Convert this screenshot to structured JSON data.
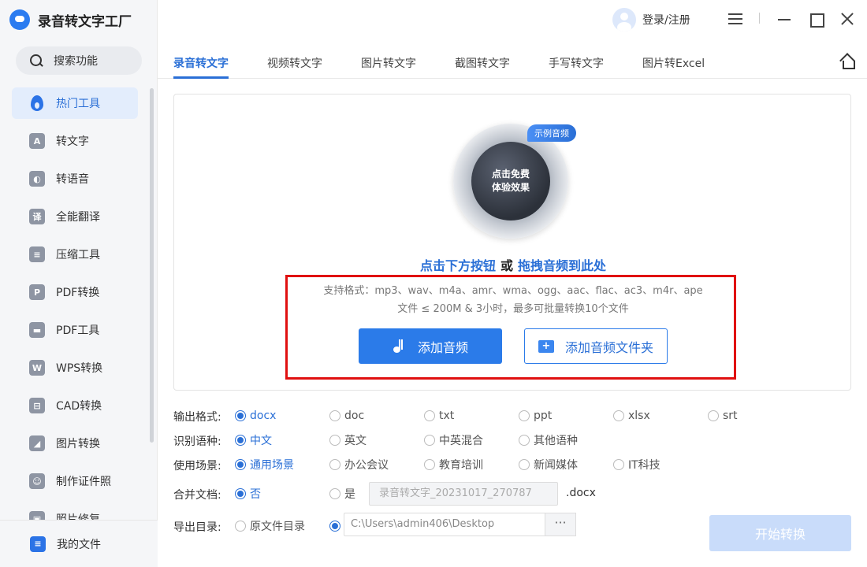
{
  "app": {
    "title": "录音转文字工厂"
  },
  "search": {
    "label": "搜索功能"
  },
  "sidebar": {
    "items": [
      {
        "label": "热门工具",
        "icon": "flame-icon",
        "glyph": ""
      },
      {
        "label": "转文字",
        "icon": "text-icon",
        "glyph": "A"
      },
      {
        "label": "转语音",
        "icon": "voice-icon",
        "glyph": "◐"
      },
      {
        "label": "全能翻译",
        "icon": "translate-icon",
        "glyph": "译"
      },
      {
        "label": "压缩工具",
        "icon": "compress-icon",
        "glyph": "≡"
      },
      {
        "label": "PDF转换",
        "icon": "pdf-icon",
        "glyph": "P"
      },
      {
        "label": "PDF工具",
        "icon": "briefcase-icon",
        "glyph": "▬"
      },
      {
        "label": "WPS转换",
        "icon": "wps-icon",
        "glyph": "W"
      },
      {
        "label": "CAD转换",
        "icon": "cad-icon",
        "glyph": "⊟"
      },
      {
        "label": "图片转换",
        "icon": "image-icon",
        "glyph": "◢"
      },
      {
        "label": "制作证件照",
        "icon": "id-photo-icon",
        "glyph": "☺"
      },
      {
        "label": "照片修复",
        "icon": "photo-repair-icon",
        "glyph": "▣"
      }
    ],
    "my_files": "我的文件"
  },
  "header": {
    "login": "登录/注册"
  },
  "tabs": [
    "录音转文字",
    "视频转文字",
    "图片转文字",
    "截图转文字",
    "手写转文字",
    "图片转Excel"
  ],
  "upload": {
    "badge": "示例音频",
    "disc_line1": "点击免费",
    "disc_line2": "体验效果",
    "hint_part1": "点击下方按钮",
    "hint_or": "或",
    "hint_part2": "拖拽音频到此处",
    "formats": "支持格式：mp3、wav、m4a、amr、wma、ogg、aac、flac、ac3、m4r、ape",
    "limits": "文件 ≤ 200M & 3小时，最多可批量转换10个文件",
    "add_audio": "添加音频",
    "add_folder": "添加音频文件夹"
  },
  "options": {
    "output_format": {
      "label": "输出格式:",
      "choices": [
        "docx",
        "doc",
        "txt",
        "ppt",
        "xlsx",
        "srt"
      ],
      "selected": "docx"
    },
    "language": {
      "label": "识别语种:",
      "choices": [
        "中文",
        "英文",
        "中英混合",
        "其他语种"
      ],
      "selected": "中文"
    },
    "scene": {
      "label": "使用场景:",
      "choices": [
        "通用场景",
        "办公会议",
        "教育培训",
        "新闻媒体",
        "IT科技"
      ],
      "selected": "通用场景"
    },
    "merge": {
      "label": "合并文档:",
      "no": "否",
      "yes": "是",
      "selected": "否",
      "filename": "录音转文字_20231017_270787",
      "ext": ".docx"
    },
    "export": {
      "label": "导出目录:",
      "source_dir": "原文件目录",
      "path": "C:\\Users\\admin406\\Desktop",
      "more": "···",
      "selected": "custom"
    }
  },
  "start_button": "开始转换",
  "colors": {
    "accent": "#2b7be9",
    "highlight_box": "#e01010",
    "start_disabled": "#c9dcfa"
  }
}
